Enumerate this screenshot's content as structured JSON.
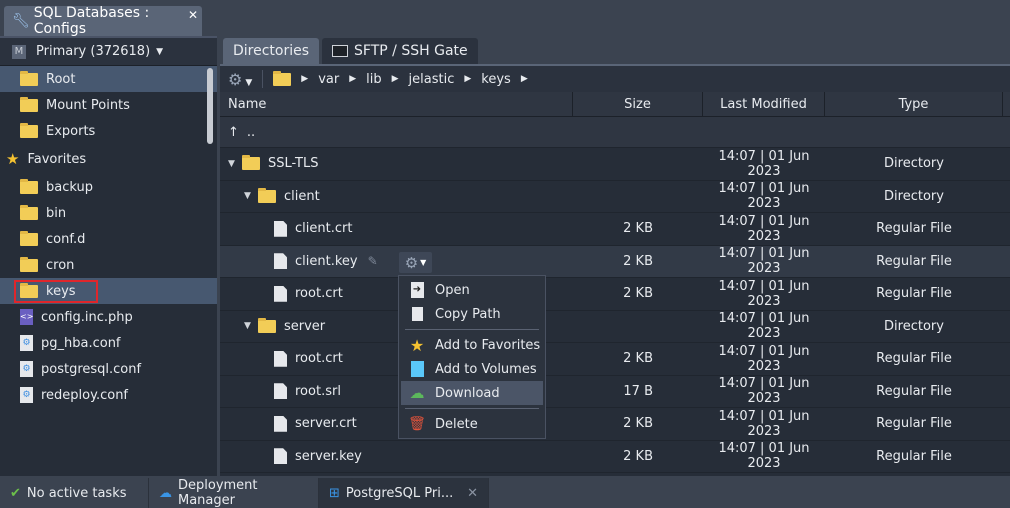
{
  "window": {
    "title": "SQL Databases : Configs",
    "close": "✕"
  },
  "sidebar": {
    "node": "Primary (372618)",
    "badge": "M",
    "top_items": [
      {
        "label": "Root",
        "icon": "folder-icon"
      },
      {
        "label": "Mount Points",
        "icon": "mount-icon"
      },
      {
        "label": "Exports",
        "icon": "exports-icon"
      }
    ],
    "favorites_label": "Favorites",
    "favorites": [
      {
        "label": "backup",
        "type": "folder"
      },
      {
        "label": "bin",
        "type": "folder"
      },
      {
        "label": "conf.d",
        "type": "folder"
      },
      {
        "label": "cron",
        "type": "folder"
      },
      {
        "label": "keys",
        "type": "folder"
      },
      {
        "label": "config.inc.php",
        "type": "php"
      },
      {
        "label": "pg_hba.conf",
        "type": "conf"
      },
      {
        "label": "postgresql.conf",
        "type": "conf"
      },
      {
        "label": "redeploy.conf",
        "type": "conf"
      }
    ]
  },
  "tabs": [
    {
      "label": "Directories"
    },
    {
      "label": "SFTP / SSH Gate"
    }
  ],
  "breadcrumb": [
    "var",
    "lib",
    "jelastic",
    "keys"
  ],
  "columns": [
    "Name",
    "Size",
    "Last Modified",
    "Type"
  ],
  "up_label": "..",
  "rows": [
    {
      "name": "SSL-TLS",
      "size": "",
      "modified": "14:07 | 01 Jun 2023",
      "type": "Directory",
      "level": 0,
      "dir": true
    },
    {
      "name": "client",
      "size": "",
      "modified": "14:07 | 01 Jun 2023",
      "type": "Directory",
      "level": 1,
      "dir": true
    },
    {
      "name": "client.crt",
      "size": "2 KB",
      "modified": "14:07 | 01 Jun 2023",
      "type": "Regular File",
      "level": 2,
      "dir": false
    },
    {
      "name": "client.key",
      "size": "2 KB",
      "modified": "14:07 | 01 Jun 2023",
      "type": "Regular File",
      "level": 2,
      "dir": false
    },
    {
      "name": "root.crt",
      "size": "2 KB",
      "modified": "14:07 | 01 Jun 2023",
      "type": "Regular File",
      "level": 2,
      "dir": false
    },
    {
      "name": "server",
      "size": "",
      "modified": "14:07 | 01 Jun 2023",
      "type": "Directory",
      "level": 1,
      "dir": true
    },
    {
      "name": "root.crt",
      "size": "2 KB",
      "modified": "14:07 | 01 Jun 2023",
      "type": "Regular File",
      "level": 2,
      "dir": false
    },
    {
      "name": "root.srl",
      "size": "17 B",
      "modified": "14:07 | 01 Jun 2023",
      "type": "Regular File",
      "level": 2,
      "dir": false
    },
    {
      "name": "server.crt",
      "size": "2 KB",
      "modified": "14:07 | 01 Jun 2023",
      "type": "Regular File",
      "level": 2,
      "dir": false
    },
    {
      "name": "server.key",
      "size": "2 KB",
      "modified": "14:07 | 01 Jun 2023",
      "type": "Regular File",
      "level": 2,
      "dir": false
    }
  ],
  "context_menu": [
    {
      "label": "Open",
      "icon": "open-icon"
    },
    {
      "label": "Copy Path",
      "icon": "copy-icon"
    },
    {
      "label": "Add to Favorites",
      "icon": "star-icon"
    },
    {
      "label": "Add to Volumes",
      "icon": "volume-icon"
    },
    {
      "label": "Download",
      "icon": "download-icon"
    },
    {
      "label": "Delete",
      "icon": "trash-icon"
    }
  ],
  "status": {
    "tasks": "No active tasks",
    "deployment": "Deployment Manager",
    "env": "PostgreSQL Pri..."
  }
}
